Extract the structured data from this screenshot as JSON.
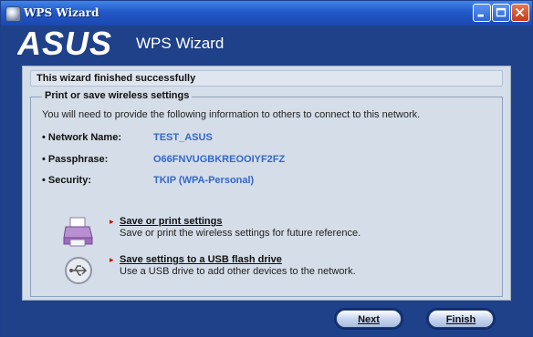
{
  "window": {
    "title": "WPS Wizard",
    "controls": [
      "minimize-icon",
      "maximize-icon",
      "close-icon"
    ]
  },
  "header": {
    "logo_text": "ASUS",
    "title": "WPS Wizard"
  },
  "status": {
    "message": "This wizard finished successfully"
  },
  "settings_group": {
    "legend": "Print or save wireless settings",
    "intro": "You will need to provide the following information to others to connect to this network.",
    "fields": [
      {
        "label": "• Network Name:",
        "value": "TEST_ASUS"
      },
      {
        "label": "• Passphrase:",
        "value": "O66FNVUGBKREOOIYF2FZ"
      },
      {
        "label": "• Security:",
        "value": "TKIP (WPA-Personal)"
      }
    ]
  },
  "options": [
    {
      "icon": "printer-icon",
      "arrow": "▸",
      "link": "Save or print settings",
      "desc": "Save or print the wireless settings for future reference."
    },
    {
      "icon": "usb-icon",
      "arrow": "▸",
      "link": "Save settings to a USB flash drive",
      "desc": "Use a USB drive to add other devices to the network."
    }
  ],
  "buttons": {
    "next": "Next",
    "finish": "Finish"
  },
  "colors": {
    "title_bar": "#2358c8",
    "header_bg": "#1f4189",
    "panel_bg": "#d4dde8",
    "value_text": "#3567c9"
  }
}
